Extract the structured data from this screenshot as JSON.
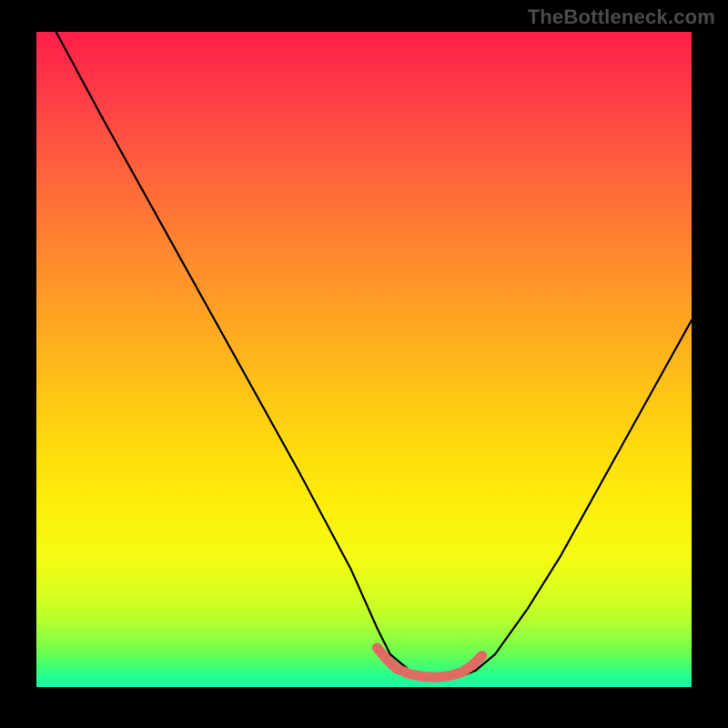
{
  "watermark": "TheBottleneck.com",
  "chart_data": {
    "type": "line",
    "title": "",
    "xlabel": "",
    "ylabel": "",
    "xlim": [
      0,
      100
    ],
    "ylim": [
      0,
      100
    ],
    "grid": false,
    "series": [
      {
        "name": "curve",
        "color": "#000000",
        "x": [
          3,
          10,
          20,
          30,
          40,
          48,
          52,
          54,
          57,
          60,
          62,
          65,
          67,
          70,
          75,
          80,
          85,
          90,
          95,
          100
        ],
        "y": [
          100,
          87,
          69,
          51,
          33,
          18,
          9,
          5,
          2.5,
          1.7,
          1.6,
          1.7,
          2.5,
          5,
          12,
          20,
          29,
          38,
          47,
          56
        ]
      },
      {
        "name": "trough-highlight",
        "color": "#e06b63",
        "x": [
          52,
          53.5,
          55,
          57,
          59,
          61,
          63,
          65,
          66.5,
          68
        ],
        "y": [
          6.0,
          4.2,
          2.8,
          2.0,
          1.6,
          1.5,
          1.7,
          2.3,
          3.3,
          4.8
        ]
      }
    ],
    "gradient": {
      "direction": "vertical",
      "stops": [
        {
          "pos": 0.0,
          "color": "#ff1e49"
        },
        {
          "pos": 0.18,
          "color": "#ff5840"
        },
        {
          "pos": 0.36,
          "color": "#ff8e2c"
        },
        {
          "pos": 0.54,
          "color": "#ffc216"
        },
        {
          "pos": 0.72,
          "color": "#fdee0a"
        },
        {
          "pos": 0.86,
          "color": "#d7ff1e"
        },
        {
          "pos": 0.93,
          "color": "#89ff42"
        },
        {
          "pos": 0.975,
          "color": "#33ff80"
        },
        {
          "pos": 1.0,
          "color": "#16f9aa"
        }
      ]
    }
  }
}
